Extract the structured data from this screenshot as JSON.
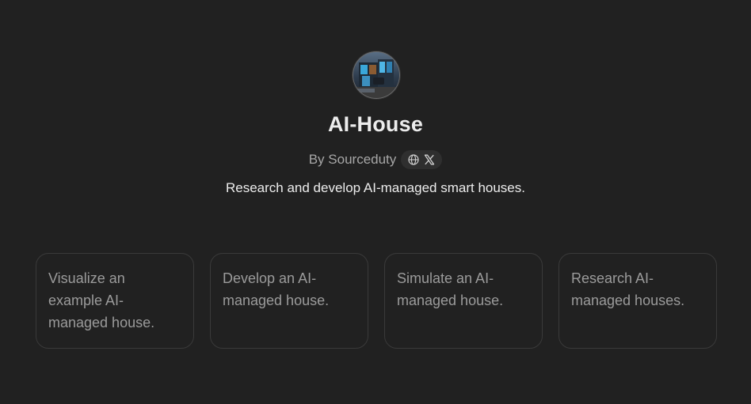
{
  "gpt": {
    "name": "AI-House",
    "author": "By Sourceduty",
    "description": "Research and develop AI-managed smart houses."
  },
  "social_links": [
    {
      "icon": "globe-icon"
    },
    {
      "icon": "x-logo-icon"
    }
  ],
  "conversation_starters": [
    {
      "label": "Visualize an example AI-managed house."
    },
    {
      "label": "Develop an AI-managed house."
    },
    {
      "label": "Simulate an AI-managed house."
    },
    {
      "label": "Research AI-managed houses."
    }
  ],
  "colors": {
    "background": "#212121",
    "card_border": "#3a3a3a",
    "muted_text": "#9b9b9b",
    "pill_background": "#2f2f2f"
  }
}
